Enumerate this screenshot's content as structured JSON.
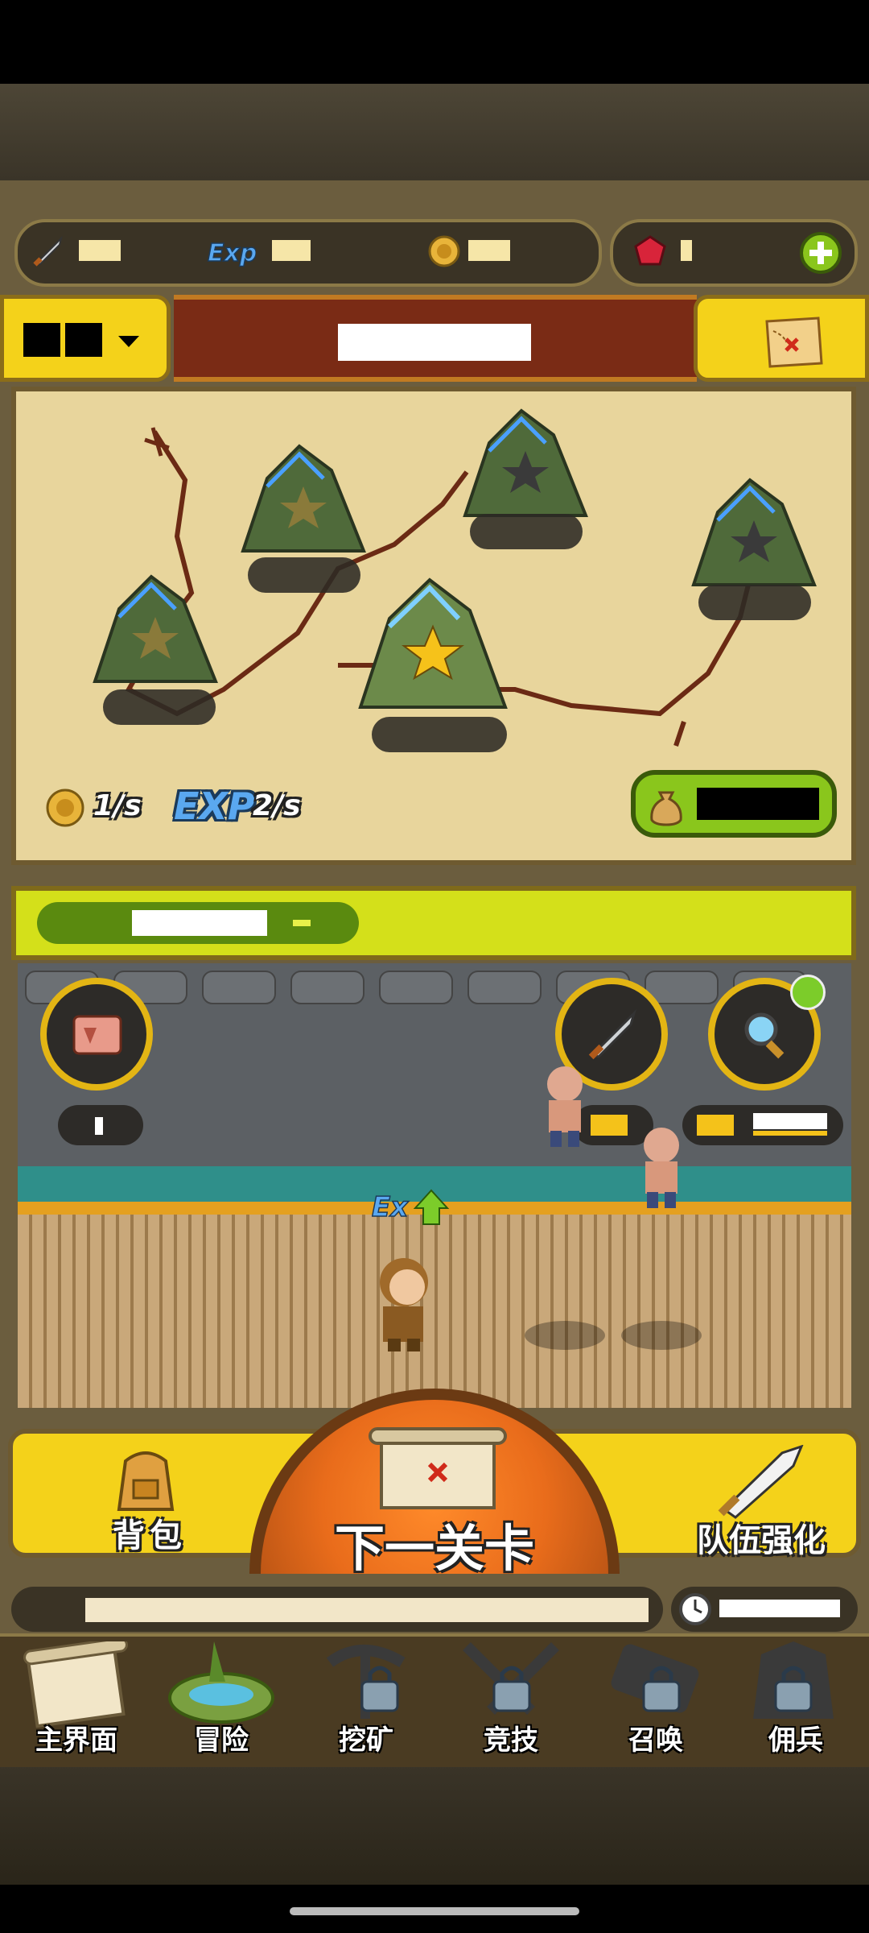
{
  "rates": {
    "gold": "1/s",
    "exp": "2/s"
  },
  "action_bar": {
    "backpack_label": "背包",
    "next_stage_label": "下一关卡",
    "team_upgrade_label": "队伍强化"
  },
  "nav": {
    "items": [
      {
        "label": "主界面",
        "locked": false
      },
      {
        "label": "冒险",
        "locked": false
      },
      {
        "label": "挖矿",
        "locked": true
      },
      {
        "label": "竞技",
        "locked": true
      },
      {
        "label": "召唤",
        "locked": true
      },
      {
        "label": "佣兵",
        "locked": true
      }
    ]
  },
  "colors": {
    "accent_yellow": "#f4d21a",
    "banner_red": "#7a2b15",
    "stage_green": "#d4e01a",
    "next_button_orange": "#e96c1b"
  },
  "icons": {
    "attack": "sword-icon",
    "exp": "exp-icon",
    "gold": "coin-icon",
    "gem": "ruby-icon",
    "add": "plus-icon",
    "map": "treasure-map-icon",
    "skill": "scroll-icon",
    "search": "magnifier-icon"
  }
}
